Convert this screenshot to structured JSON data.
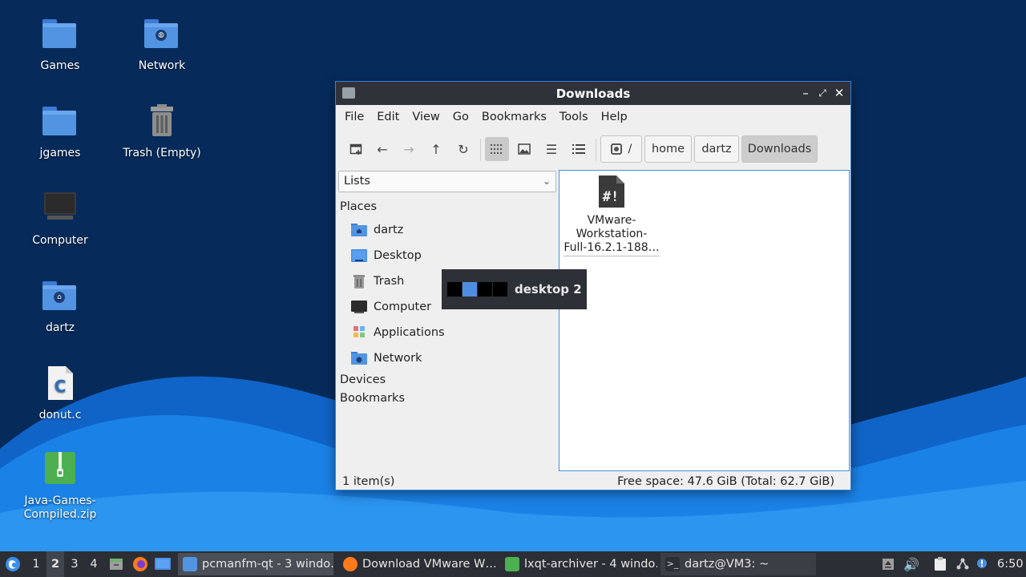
{
  "desktop": {
    "icons": [
      {
        "label": "Games",
        "icon": "folder-icon"
      },
      {
        "label": "Network",
        "icon": "network-folder-icon"
      },
      {
        "label": "jgames",
        "icon": "folder-icon"
      },
      {
        "label": "Trash (Empty)",
        "icon": "trash-icon"
      },
      {
        "label": "Computer",
        "icon": "computer-icon"
      },
      {
        "label": "dartz",
        "icon": "home-folder-icon"
      },
      {
        "label": "donut.c",
        "icon": "c-source-file-icon"
      },
      {
        "label": "Java-Games-\nCompiled.zip",
        "icon": "zip-archive-icon"
      }
    ]
  },
  "window": {
    "title": "Downloads",
    "controls": {
      "minimize": "–",
      "maximize": "⤢",
      "close": "✕"
    },
    "menu": [
      "File",
      "Edit",
      "View",
      "Go",
      "Bookmarks",
      "Tools",
      "Help"
    ],
    "breadcrumb": {
      "root": "/",
      "items": [
        "home",
        "dartz",
        "Downloads"
      ]
    },
    "sidepane": {
      "mode": "Lists",
      "places_header": "Places",
      "places": [
        "dartz",
        "Desktop",
        "Trash",
        "Computer",
        "Applications",
        "Network"
      ],
      "devices_header": "Devices",
      "bookmarks_header": "Bookmarks"
    },
    "files": [
      {
        "name": "VMware-\nWorkstation-\nFull-16.2.1-188…",
        "icon": "script-file-icon"
      }
    ],
    "status": {
      "count": "1 item(s)",
      "free": "Free space: 47.6 GiB (Total: 62.7 GiB)"
    }
  },
  "osd": {
    "label": "desktop 2",
    "current_desktop": 2,
    "desktops": 4
  },
  "taskbar": {
    "desktops": [
      "1",
      "2",
      "3",
      "4"
    ],
    "tasks": [
      {
        "label": "pcmanfm-qt - 3 windo…",
        "active": true
      },
      {
        "label": "Download VMware W…",
        "active": false
      },
      {
        "label": "lxqt-archiver - 4 windo…",
        "active": false
      },
      {
        "label": "dartz@VM3: ~",
        "active": false
      }
    ],
    "clock": "6:50"
  },
  "colors": {
    "accent": "#4a8ee2",
    "folder": "#5294e2",
    "titlebar": "#2f3239",
    "taskbar": "#2b2e34"
  }
}
